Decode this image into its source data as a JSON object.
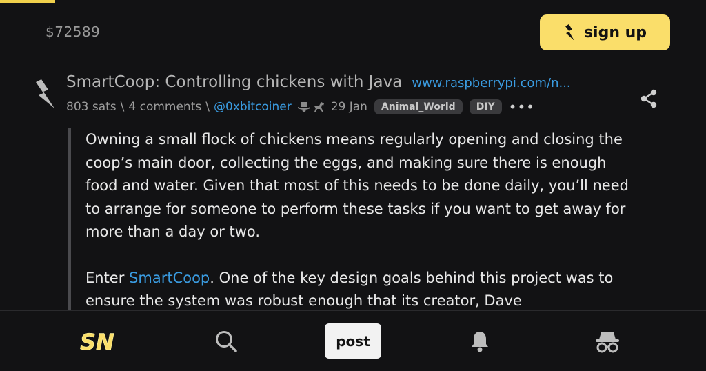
{
  "header": {
    "price": "$72589",
    "signup_label": "sign up"
  },
  "item": {
    "title": "SmartCoop: Controlling chickens with Java",
    "domain": "www.raspberrypi.com/n...",
    "sats": "803 sats",
    "comments": "4 comments",
    "user": "@0xbitcoiner",
    "date": "29 Jan",
    "tags": [
      "Animal_World",
      "DIY"
    ],
    "more": "•••"
  },
  "body": {
    "para1": "Owning a small flock of chickens means regularly opening and closing the coop’s main door, collecting the eggs, and making sure there is enough food and water. Given that most of this needs to be done daily, you’ll need to arrange for someone to perform these tasks if you want to get away for more than a day or two.",
    "para2_prefix": "Enter ",
    "para2_link": "SmartCoop",
    "para2_rest": ". One of the key design goals behind this project was to ensure the system was robust enough that its creator, Dave"
  },
  "nav": {
    "post_label": "post",
    "items": [
      "home-logo-icon",
      "search-icon",
      "post-button",
      "bell-icon",
      "incognito-icon"
    ]
  },
  "colors": {
    "accent": "#fade6a",
    "link": "#3a9be0",
    "background": "#121214"
  }
}
